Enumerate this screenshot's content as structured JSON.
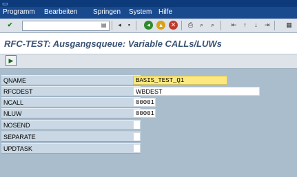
{
  "menu": {
    "items": [
      "Programm",
      "Bearbeiten",
      "Springen",
      "System",
      "Hilfe"
    ]
  },
  "toolbar": {
    "command_value": ""
  },
  "page": {
    "title": "RFC-TEST:  Ausgangsqueue: Variable CALLs/LUWs"
  },
  "form": {
    "fields": [
      {
        "label": "QNAME",
        "value": "BASIS_TEST_Q1"
      },
      {
        "label": "RFCDEST",
        "value": "WBDEST"
      },
      {
        "label": "NCALL",
        "value": "00001"
      },
      {
        "label": "NLUW",
        "value": "00001"
      },
      {
        "label": "NOSEND",
        "value": ""
      },
      {
        "label": "SEPARATE",
        "value": ""
      },
      {
        "label": "UPDTASK",
        "value": ""
      }
    ]
  },
  "icons": {
    "system": "sap-system-icon",
    "execute": "execute-icon",
    "enter": "enter-check-icon"
  },
  "colors": {
    "menubar": "#1a4a8e",
    "background": "#a9bdcd",
    "title": "#3a5273",
    "required_field": "#fbe97f"
  }
}
